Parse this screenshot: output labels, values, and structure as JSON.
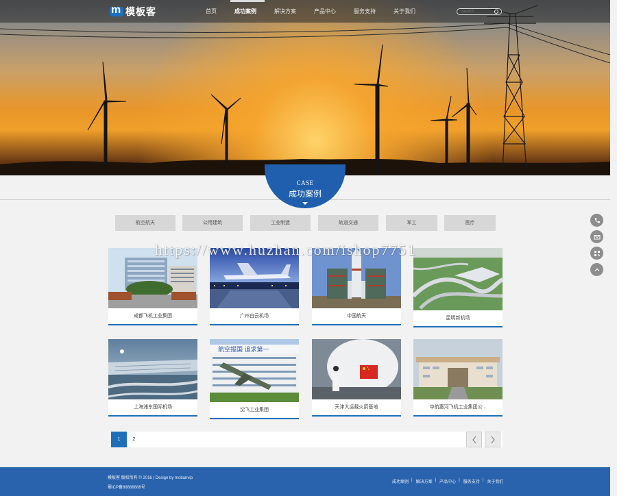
{
  "header": {
    "logo_text": "模板客",
    "nav": [
      {
        "label": "首页"
      },
      {
        "label": "成功案例",
        "active": true
      },
      {
        "label": "解决方案"
      },
      {
        "label": "产品中心"
      },
      {
        "label": "服务支持"
      },
      {
        "label": "关于我们"
      }
    ],
    "search_placeholder": "Search"
  },
  "section": {
    "title_en": "CASE",
    "title_cn": "成功案例"
  },
  "filters": [
    "航空航天",
    "公用建筑",
    "工业制造",
    "轨道交通",
    "军工",
    "医疗"
  ],
  "watermark": "https://www.huzhan.com/ishop7751",
  "cases": [
    {
      "title": "成都飞机工业集团"
    },
    {
      "title": "广州白云机场"
    },
    {
      "title": "中国航天"
    },
    {
      "title": "昆明新机场"
    },
    {
      "title": "上海浦东国际机场"
    },
    {
      "title": "沈飞工业集团"
    },
    {
      "title": "天津大运载火箭基地"
    },
    {
      "title": "中航惠河飞机工业集团公..."
    }
  ],
  "pagination": {
    "pages": [
      "1",
      "2"
    ],
    "current": "1",
    "prev_icon": "chevron-left-icon",
    "next_icon": "chevron-right-icon"
  },
  "side_tools": [
    "phone-icon",
    "mail-icon",
    "qrcode-icon",
    "back-to-top-icon"
  ],
  "footer": {
    "copyright": "模板客 版权所有 © 2016 | Design by mobanvip",
    "icp": "蜀ICP备88888888号",
    "links": [
      "成功案例",
      "解决方案",
      "产品中心",
      "服务支持",
      "关于我们"
    ]
  },
  "colors": {
    "accent": "#1f6fb8",
    "badge": "#1f5fad",
    "footer": "#2a63ad",
    "filter_bg": "#d7d7d7"
  }
}
